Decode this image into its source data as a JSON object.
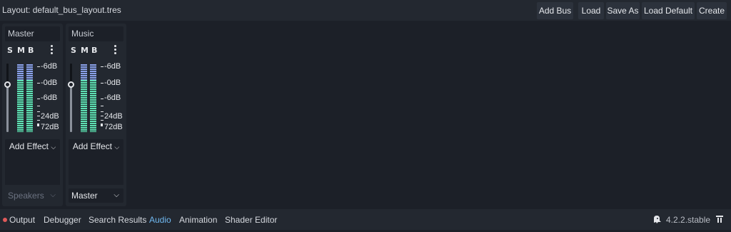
{
  "toolbar": {
    "layout_label": "Layout: default_bus_layout.tres",
    "add_bus": "Add Bus",
    "load": "Load",
    "save_as": "Save As",
    "load_default": "Load Default",
    "create": "Create"
  },
  "buses": [
    {
      "name": "Master",
      "solo": "S",
      "mute": "M",
      "bypass": "B",
      "db_labels": [
        "-6dB",
        "-0dB",
        "-6dB",
        "24dB",
        "72dB"
      ],
      "add_effect": "Add Effect",
      "output": "Speakers"
    },
    {
      "name": "Music",
      "solo": "S",
      "mute": "M",
      "bypass": "B",
      "db_labels": [
        "-6dB",
        "-0dB",
        "-6dB",
        "24dB",
        "72dB"
      ],
      "add_effect": "Add Effect",
      "output": "Master"
    }
  ],
  "bottom_tabs": [
    "Output",
    "Debugger",
    "Search Results",
    "Audio",
    "Animation",
    "Shader Editor"
  ],
  "active_tab": "Audio",
  "version": "4.2.2.stable",
  "icons": {
    "bus_menu": "kebab-menu-icon",
    "dropdown": "chevron-down-icon",
    "version": "ghost-icon",
    "pin": "pin-icon",
    "output_status": "error-dot-icon"
  },
  "colors": {
    "accent": "#70b8f0",
    "meter_green": "#5fe0b4",
    "meter_blue": "#8aa0e8",
    "error_dot": "#e05a5a"
  }
}
